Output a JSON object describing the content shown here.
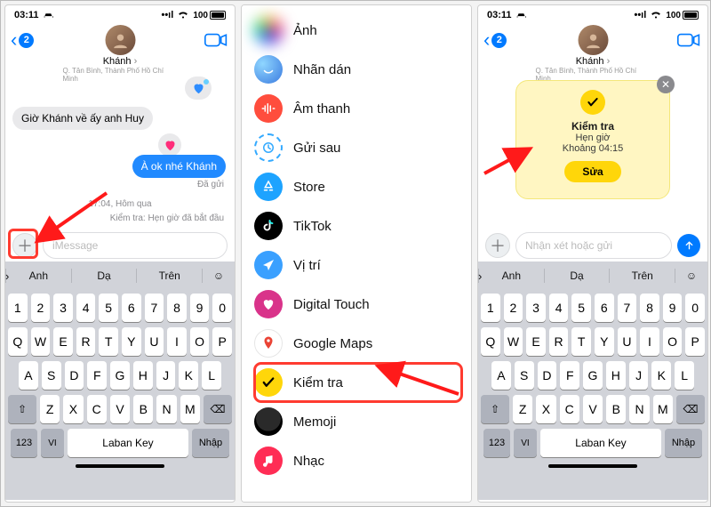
{
  "statusbar": {
    "time": "03:11",
    "battery": "100"
  },
  "header": {
    "back_count": "2",
    "contact_name": "Khánh",
    "contact_sub": "Q. Tân Bình, Thành Phố Hồ Chí Minh"
  },
  "chat": {
    "msg_grey": "Giờ Khánh về ấy anh Huy",
    "msg_blue": "À ok nhé Khánh",
    "status_sent": "Đã gửi",
    "time_label": "17:04, Hôm qua",
    "checkin_started": "Kiểm tra: Hẹn giờ đã bắt đầu"
  },
  "input": {
    "placeholder_imsg": "iMessage",
    "placeholder_send": "Nhận xét hoặc gửi"
  },
  "keyboard": {
    "predictions": [
      "Anh",
      "Dạ",
      "Trên"
    ],
    "nums": [
      "1",
      "2",
      "3",
      "4",
      "5",
      "6",
      "7",
      "8",
      "9",
      "0"
    ],
    "r1": [
      "Q",
      "W",
      "E",
      "R",
      "T",
      "Y",
      "U",
      "I",
      "O",
      "P"
    ],
    "r2": [
      "A",
      "S",
      "D",
      "F",
      "G",
      "H",
      "J",
      "K",
      "L"
    ],
    "r3": [
      "Z",
      "X",
      "C",
      "V",
      "B",
      "N",
      "M"
    ],
    "key_123": "123",
    "key_vi": "VI",
    "space_label": "Laban Key",
    "enter_label": "Nhập"
  },
  "menu": {
    "items": [
      {
        "label": "Ảnh"
      },
      {
        "label": "Nhãn dán"
      },
      {
        "label": "Âm thanh"
      },
      {
        "label": "Gửi sau"
      },
      {
        "label": "Store"
      },
      {
        "label": "TikTok"
      },
      {
        "label": "Vị trí"
      },
      {
        "label": "Digital Touch"
      },
      {
        "label": "Google Maps"
      },
      {
        "label": "Kiểm tra"
      },
      {
        "label": "Memoji"
      },
      {
        "label": "Nhạc"
      }
    ]
  },
  "card": {
    "title": "Kiểm tra",
    "sub1": "Hẹn giờ",
    "sub2": "Khoảng 04:15",
    "button": "Sửa"
  }
}
